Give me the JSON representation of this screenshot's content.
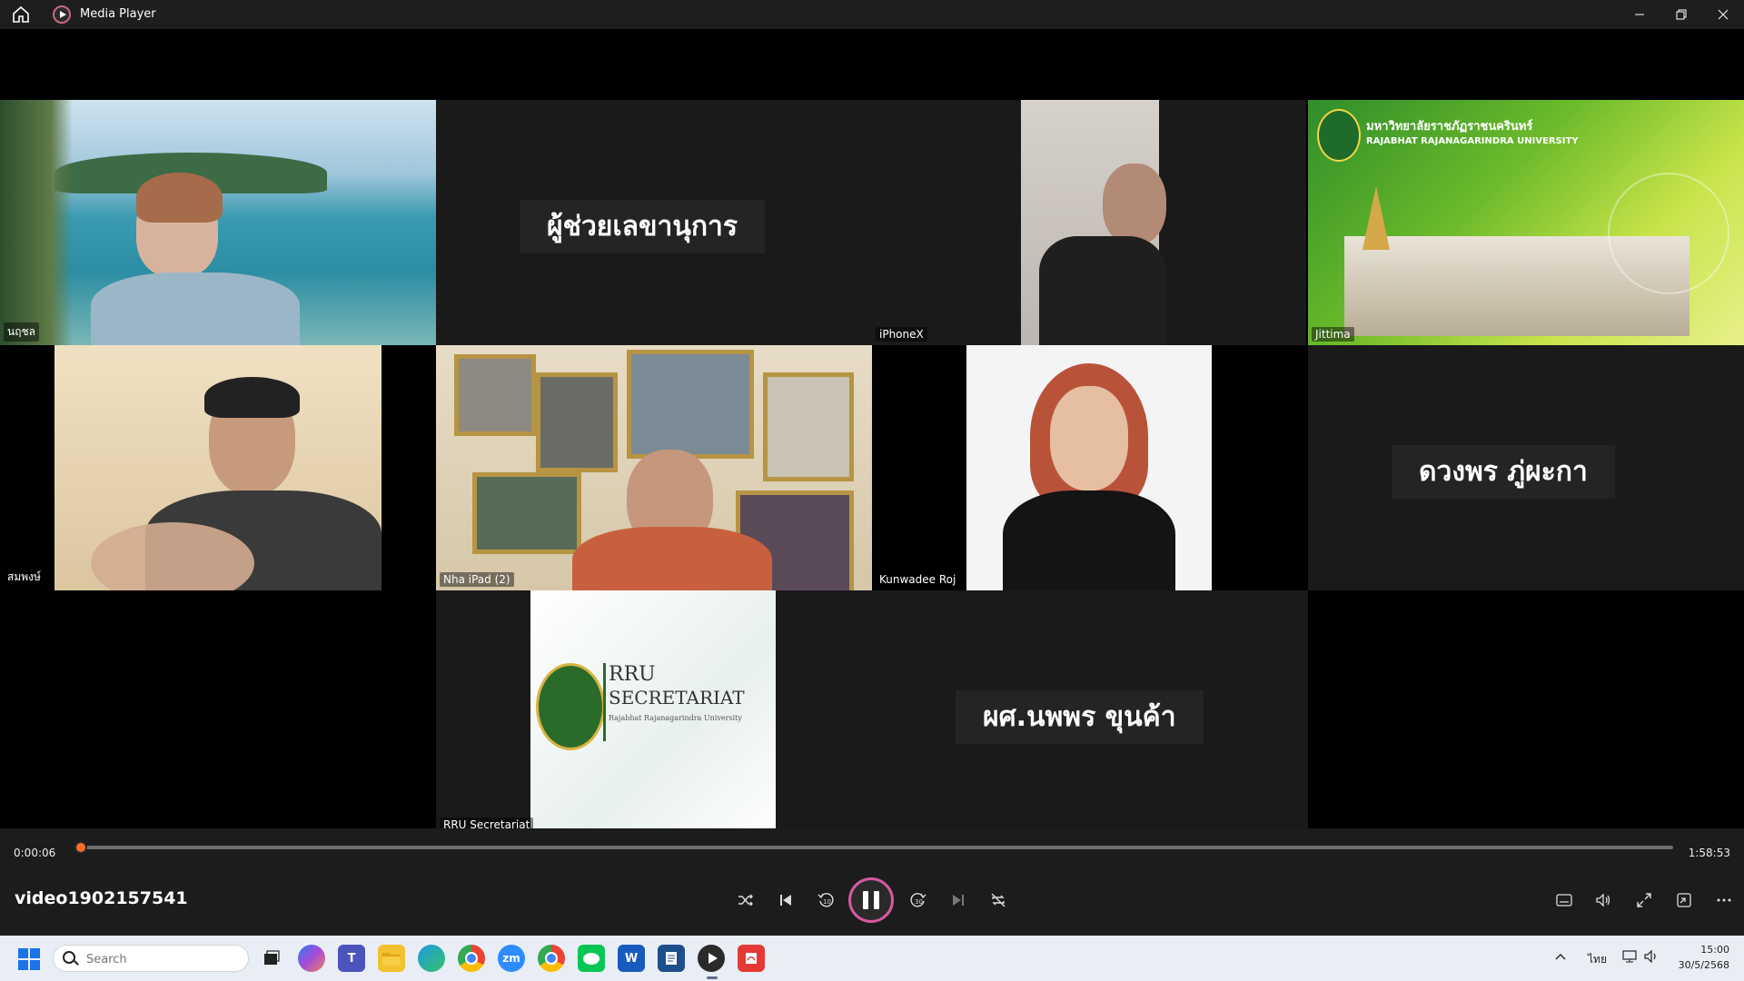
{
  "window": {
    "title": "Media Player"
  },
  "stage": {
    "tiles": [
      {
        "name": "นฤชล"
      },
      {
        "display_name": "ผู้ช่วยเลขานุการ"
      },
      {
        "name": "iPhoneX"
      },
      {
        "name": "Jittima",
        "banner_thai": "มหาวิทยาลัยราชภัฏราชนครินทร์",
        "banner_en": "RAJABHAT RAJANAGARINDRA UNIVERSITY"
      },
      {
        "name": "สมพงษ์"
      },
      {
        "name": "Nha iPad (2)"
      },
      {
        "name": "Kunwadee Roj"
      },
      {
        "display_name": "ดวงพร ภู่ผะกา"
      },
      {
        "name": "RRU Secretariat",
        "logo_text_1": "RRU",
        "logo_text_2": "SECRETARIAT",
        "logo_sub": "Rajabhat Rajanagarindra University"
      },
      {
        "display_name": "ผศ.นพพร ขุนค้า"
      }
    ]
  },
  "controls": {
    "current_time": "0:00:06",
    "total_time": "1:58:53",
    "progress": 0.0008,
    "video_title": "video1902157541"
  },
  "taskbar": {
    "search_placeholder": "Search",
    "zoom_label": "zm",
    "word_label": "W",
    "language": "ไทย",
    "time": "15:00",
    "date": "30/5/2568"
  },
  "colors": {
    "accent": "#d45aa0",
    "progress_thumb": "#ff6a2a",
    "taskbar_bg": "#e9eef6"
  }
}
